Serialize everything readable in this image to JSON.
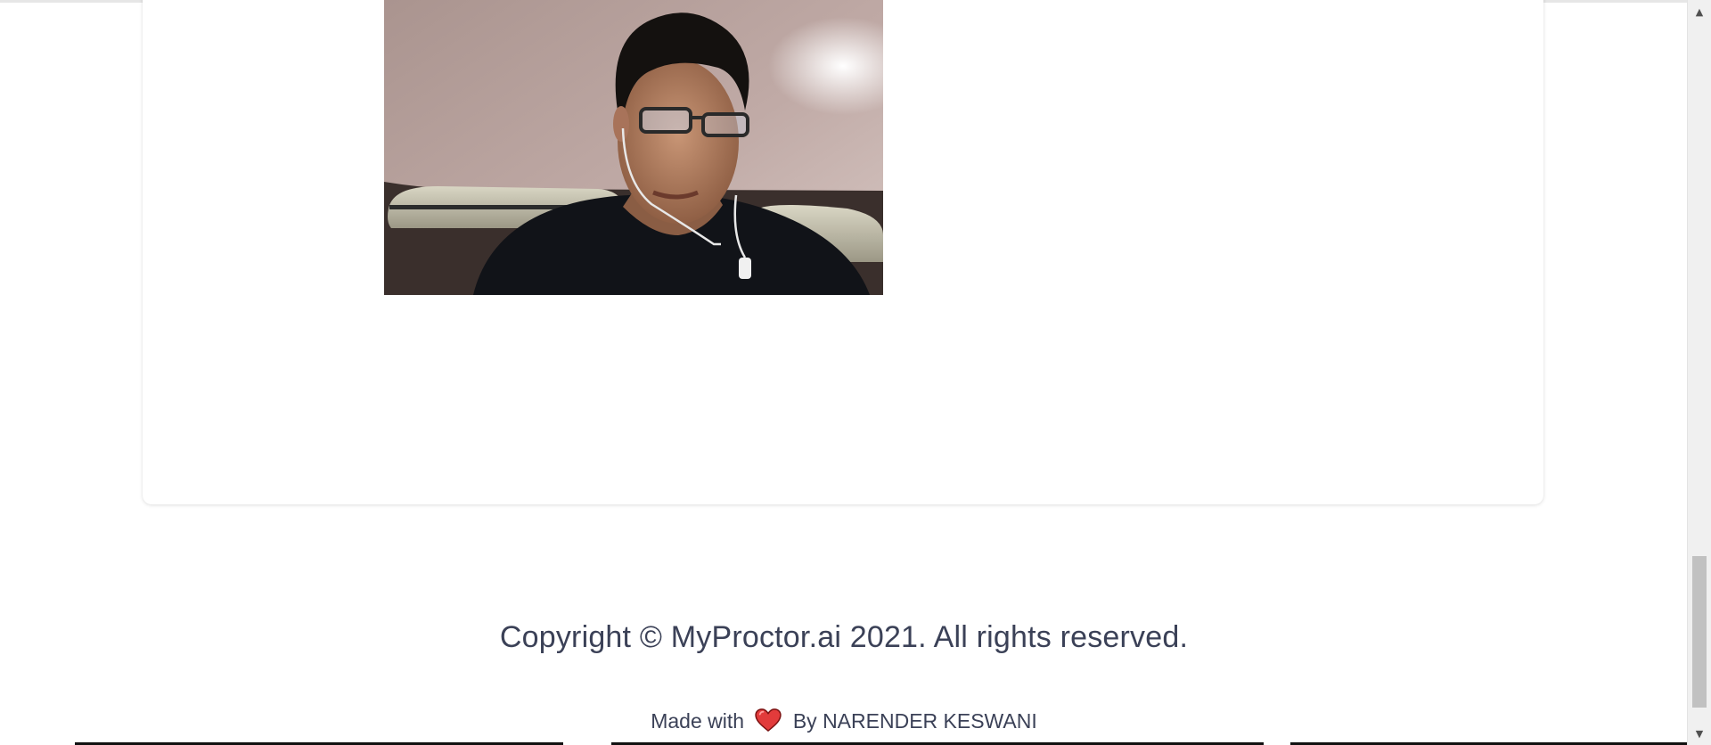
{
  "webcam": {
    "alt": "Webcam snapshot of candidate"
  },
  "footer": {
    "copyright": "Copyright © MyProctor.ai 2021. All rights reserved.",
    "made_with": "Made with",
    "by": "By NARENDER KESWANI"
  },
  "icons": {
    "heart": "heart-icon",
    "scroll_up": "scroll-up-arrow-icon",
    "scroll_down": "scroll-down-arrow-icon"
  },
  "colors": {
    "text": "#3b4157",
    "heart": "#e23b3b",
    "card_bg": "#ffffff"
  },
  "scroll": {
    "position_fraction": 0.96
  }
}
